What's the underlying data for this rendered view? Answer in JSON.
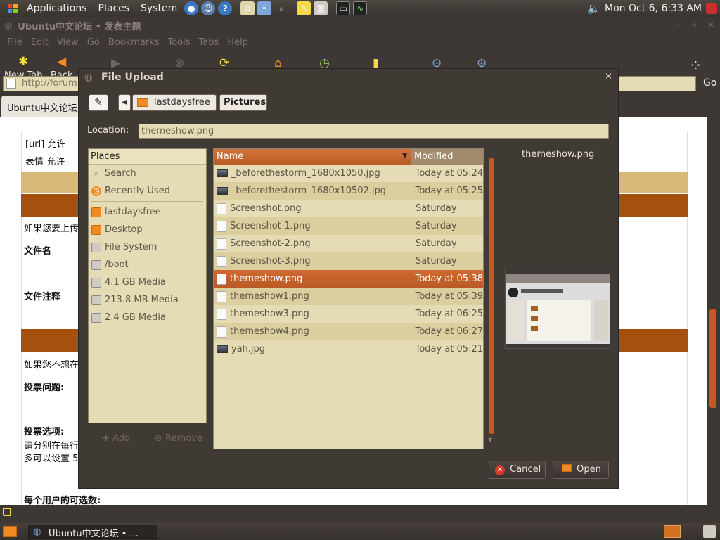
{
  "top_panel": {
    "menus": [
      "Applications",
      "Places",
      "System"
    ],
    "clock": "Mon Oct  6,  6:33 AM"
  },
  "browser": {
    "title": "Ubuntu中文论坛 • 发表主题",
    "menus": [
      "File",
      "Edit",
      "View",
      "Go",
      "Bookmarks",
      "Tools",
      "Tabs",
      "Help"
    ],
    "toolbar": {
      "new_tab": "New Tab",
      "back": "Back"
    },
    "url": "http://forum.",
    "go": "Go",
    "tab_label": "Ubuntu中文论坛"
  },
  "page": {
    "lines": [
      "[url] 允许",
      "表情 允许",
      "如果您要上传",
      "文件名",
      "文件注释",
      "如果您不想在",
      "投票问题:",
      "投票选项:",
      "请分别在每行",
      "多可以设置 5",
      "每个用户的可选数:"
    ]
  },
  "dialog": {
    "title": "File Upload",
    "breadcrumbs": [
      "lastdaysfree",
      "Pictures"
    ],
    "location_label": "Location:",
    "location_value": "themeshow.png",
    "places_header": "Places",
    "places": [
      {
        "label": "Search",
        "icon": "search-icon"
      },
      {
        "label": "Recently Used",
        "icon": "recent-icon"
      },
      {
        "label": "lastdaysfree",
        "icon": "home-folder-icon"
      },
      {
        "label": "Desktop",
        "icon": "desktop-folder-icon"
      },
      {
        "label": "File System",
        "icon": "drive-icon"
      },
      {
        "label": "/boot",
        "icon": "drive-icon"
      },
      {
        "label": "4.1 GB Media",
        "icon": "drive-icon"
      },
      {
        "label": "213.8 MB Media",
        "icon": "drive-icon"
      },
      {
        "label": "2.4 GB Media",
        "icon": "drive-icon"
      }
    ],
    "add_label": "Add",
    "remove_label": "Remove",
    "columns": {
      "name": "Name",
      "modified": "Modified"
    },
    "files": [
      {
        "name": "_beforethestorm_1680x1050.jpg",
        "modified": "Today at 05:24",
        "type": "image"
      },
      {
        "name": "_beforethestorm_1680x10502.jpg",
        "modified": "Today at 05:25",
        "type": "image"
      },
      {
        "name": "Screenshot.png",
        "modified": "Saturday",
        "type": "file"
      },
      {
        "name": "Screenshot-1.png",
        "modified": "Saturday",
        "type": "file"
      },
      {
        "name": "Screenshot-2.png",
        "modified": "Saturday",
        "type": "file"
      },
      {
        "name": "Screenshot-3.png",
        "modified": "Saturday",
        "type": "file"
      },
      {
        "name": "themeshow.png",
        "modified": "Today at 05:38",
        "type": "file",
        "selected": true
      },
      {
        "name": "themeshow1.png",
        "modified": "Today at 05:39",
        "type": "file"
      },
      {
        "name": "themeshow3.png",
        "modified": "Today at 06:25",
        "type": "file"
      },
      {
        "name": "themeshow4.png",
        "modified": "Today at 06:27",
        "type": "file"
      },
      {
        "name": "yah.jpg",
        "modified": "Today at 05:21",
        "type": "image"
      }
    ],
    "preview_name": "themeshow.png",
    "cancel_label": "Cancel",
    "open_label": "Open"
  },
  "taskbar": {
    "item_label": "Ubuntu中文论坛 • ..."
  },
  "colors": {
    "accent": "#c8581e",
    "field_bg": "#e5dbb4",
    "panel_bg": "#3d3834"
  }
}
